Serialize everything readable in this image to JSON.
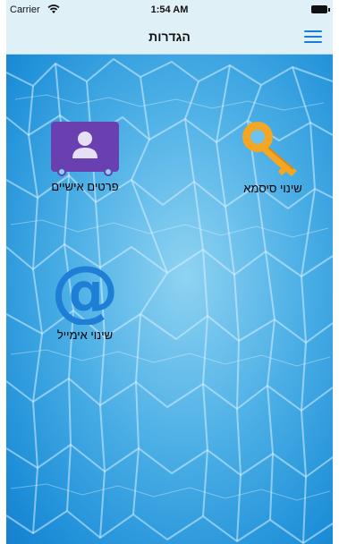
{
  "status_bar": {
    "carrier": "Carrier",
    "time": "1:54 AM"
  },
  "nav": {
    "title": "הגדרות",
    "menu_icon": "hamburger-icon"
  },
  "tiles": [
    {
      "label": "שינוי סיסמא",
      "icon": "key-icon"
    },
    {
      "label": "פרטים אישיים",
      "icon": "contact-card-icon"
    },
    {
      "label": "שינוי אימייל",
      "icon": "at-sign-icon"
    }
  ],
  "colors": {
    "nav_background": "#dff0f7",
    "accent": "#1a7ae0",
    "key": "#f5a623",
    "card": "#6a3fb0",
    "at_sign": "#1f7fd6"
  }
}
